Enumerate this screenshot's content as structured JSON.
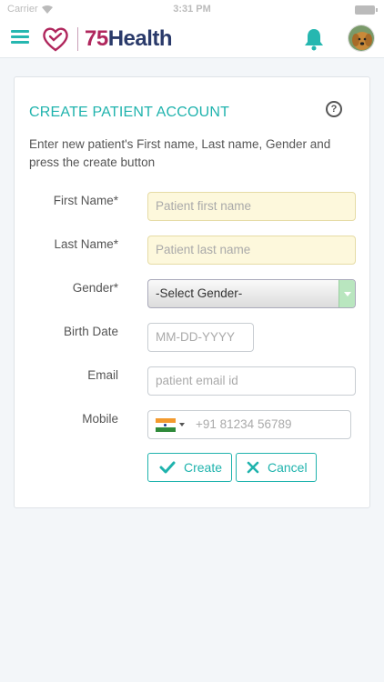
{
  "status_bar": {
    "carrier": "Carrier",
    "time": "3:31 PM"
  },
  "header": {
    "brand_number": "75",
    "brand_word": "Health",
    "accent_color": "#26b7b0"
  },
  "card": {
    "title": "CREATE PATIENT ACCOUNT",
    "description": "Enter new patient's First name, Last name, Gender and press the create button"
  },
  "form": {
    "first_name": {
      "label": "First Name*",
      "placeholder": "Patient first name"
    },
    "last_name": {
      "label": "Last Name*",
      "placeholder": "Patient last name"
    },
    "gender": {
      "label": "Gender*",
      "selected": "-Select Gender-"
    },
    "birth_date": {
      "label": "Birth Date",
      "placeholder": "MM-DD-YYYY"
    },
    "email": {
      "label": "Email",
      "placeholder": "patient email id"
    },
    "mobile": {
      "label": "Mobile",
      "placeholder": "+91 81234 56789"
    }
  },
  "actions": {
    "create_label": "Create",
    "cancel_label": "Cancel"
  }
}
